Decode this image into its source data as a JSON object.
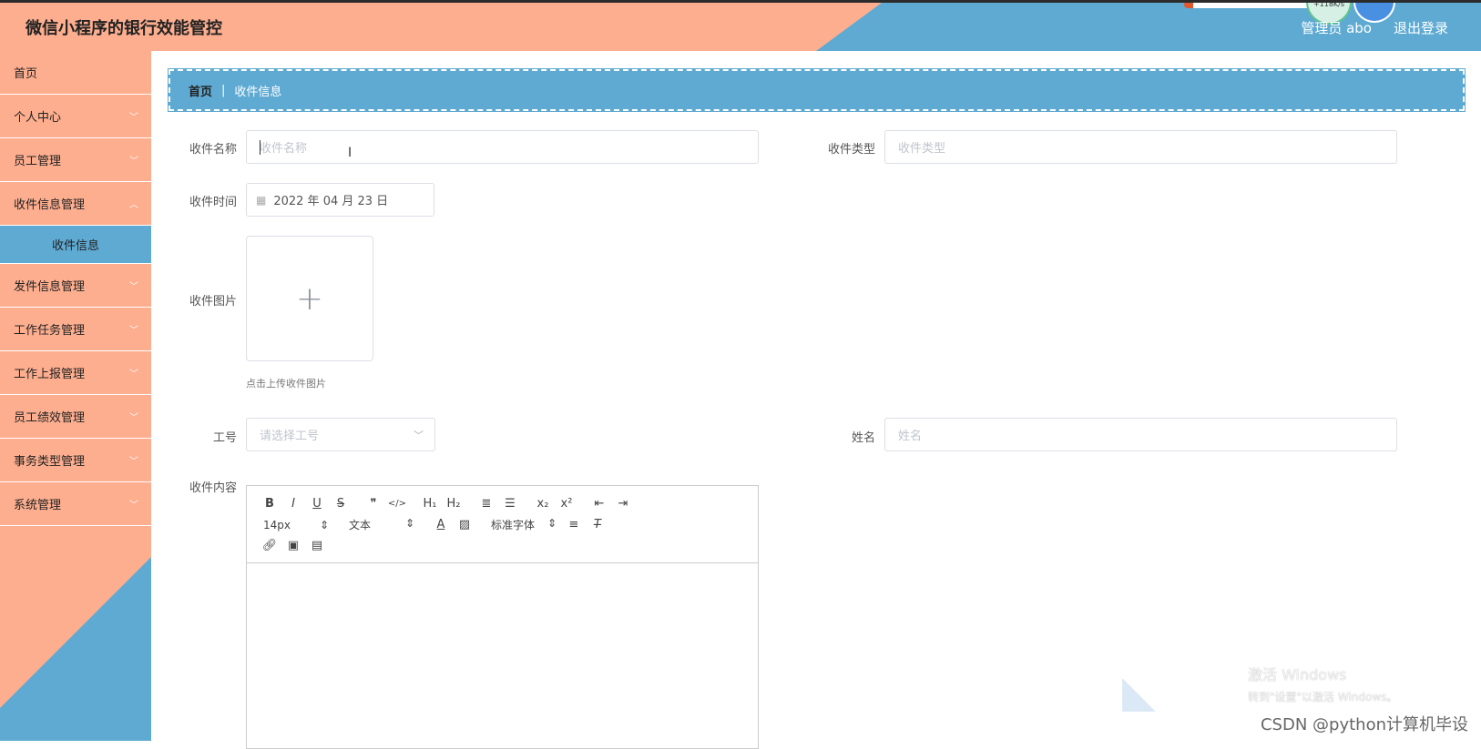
{
  "header": {
    "title": "微信小程序的银行效能管控",
    "admin_label": "管理员 abo",
    "logout_label": "退出登录",
    "widget_speed": "+118K/s"
  },
  "sidebar": {
    "items": [
      {
        "label": "首页",
        "has_children": false
      },
      {
        "label": "个人中心",
        "has_children": true
      },
      {
        "label": "员工管理",
        "has_children": true
      },
      {
        "label": "收件信息管理",
        "has_children": true
      },
      {
        "label": "发件信息管理",
        "has_children": true
      },
      {
        "label": "工作任务管理",
        "has_children": true
      },
      {
        "label": "工作上报管理",
        "has_children": true
      },
      {
        "label": "员工绩效管理",
        "has_children": true
      },
      {
        "label": "事务类型管理",
        "has_children": true
      },
      {
        "label": "系统管理",
        "has_children": true
      }
    ],
    "active_sub_item": "收件信息",
    "chevron": "chevron-down-icon"
  },
  "breadcrumb": {
    "home": "首页",
    "separator": "|",
    "current": "收件信息"
  },
  "form": {
    "name": {
      "label": "收件名称",
      "placeholder": "收件名称",
      "value": ""
    },
    "type": {
      "label": "收件类型",
      "placeholder": "收件类型",
      "value": ""
    },
    "time": {
      "label": "收件时间",
      "value": "2022 年 04 月 23 日"
    },
    "image": {
      "label": "收件图片",
      "hint": "点击上传收件图片",
      "icon": "plus-icon"
    },
    "job_no": {
      "label": "工号",
      "placeholder": "请选择工号"
    },
    "staff_name": {
      "label": "姓名",
      "placeholder": "姓名"
    },
    "content": {
      "label": "收件内容",
      "font_size": "14px",
      "paragraph": "文本",
      "font_family": "标准字体"
    }
  },
  "overlay": {
    "watermark_line1": "激活 Windows",
    "watermark_line2": "转到\"设置\"以激活 Windows。",
    "csdn": "CSDN @python计算机毕设"
  },
  "colors": {
    "salmon": "#fdae8f",
    "blue": "#5eaad2"
  }
}
